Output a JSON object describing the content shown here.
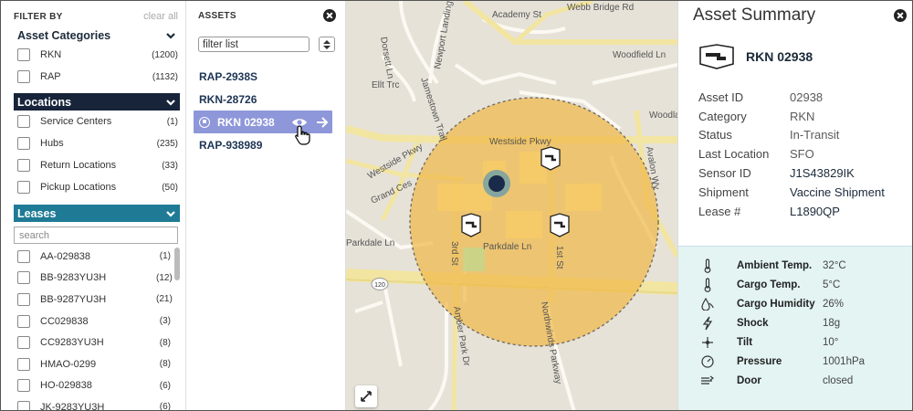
{
  "filter": {
    "title": "FILTER BY",
    "clear_all": "clear all",
    "asset_categories": {
      "label": "Asset Categories",
      "items": [
        {
          "label": "RKN",
          "count": "(1200)"
        },
        {
          "label": "RAP",
          "count": "(1132)"
        }
      ]
    },
    "locations": {
      "label": "Locations",
      "items": [
        {
          "label": "Service Centers",
          "count": "(1)"
        },
        {
          "label": "Hubs",
          "count": "(235)"
        },
        {
          "label": "Return Locations",
          "count": "(33)"
        },
        {
          "label": "Pickup Locations",
          "count": "(50)"
        }
      ]
    },
    "leases": {
      "label": "Leases",
      "search_placeholder": "search",
      "items": [
        {
          "label": "AA-029838",
          "count": "(1)"
        },
        {
          "label": "BB-9283YU3H",
          "count": "(12)"
        },
        {
          "label": "BB-9287YU3H",
          "count": "(21)"
        },
        {
          "label": "CC029838",
          "count": "(3)"
        },
        {
          "label": "CC9283YU3H",
          "count": "(8)"
        },
        {
          "label": "HMAO-0299",
          "count": "(8)"
        },
        {
          "label": "HO-029838",
          "count": "(6)"
        },
        {
          "label": "JK-9283YU3H",
          "count": "(6)"
        }
      ]
    }
  },
  "assets": {
    "title": "ASSETS",
    "filter_placeholder": "filter list",
    "items": [
      {
        "label": "RAP-2938S",
        "selected": false
      },
      {
        "label": "RKN-28726",
        "selected": false
      },
      {
        "label": "RKN 02938",
        "selected": true
      },
      {
        "label": "RAP-938989",
        "selected": false
      }
    ]
  },
  "map": {
    "street_labels": [
      "Academy St",
      "Webb Bridge Rd",
      "Jamestown Trail",
      "Dorsett Ln",
      "Newport Landing",
      "Woodfield Ln",
      "Woodland Te",
      "Westside Pkwy",
      "Avalon Wy",
      "Grand Ces",
      "Parkdale Ln",
      "3rd St",
      "Northwinds Parkway",
      "Amber Park Dr",
      "1st St",
      "Ellt Trc",
      "Parkdale Ln"
    ],
    "highway_shield": "120",
    "geofence_color": "#f0b84a",
    "marker_color": "#1a2a4a"
  },
  "summary": {
    "title": "Asset Summary",
    "asset_name": "RKN 02938",
    "fields": [
      {
        "label": "Asset ID",
        "value": "02938",
        "dark": false
      },
      {
        "label": "Category",
        "value": "RKN",
        "dark": false
      },
      {
        "label": "Status",
        "value": "In-Transit",
        "dark": false
      },
      {
        "label": "Last Location",
        "value": "SFO",
        "dark": false
      },
      {
        "label": "Sensor ID",
        "value": "J1S43829IK",
        "dark": true
      },
      {
        "label": "Shipment",
        "value": "Vaccine Shipment",
        "dark": true
      },
      {
        "label": "Lease #",
        "value": "L1890QP",
        "dark": true
      }
    ],
    "sensors": [
      {
        "icon": "thermometer-icon",
        "label": "Ambient Temp.",
        "value": "32°C"
      },
      {
        "icon": "thermometer-icon",
        "label": "Cargo Temp.",
        "value": "5°C"
      },
      {
        "icon": "humidity-icon",
        "label": "Cargo Humidity",
        "value": "26%"
      },
      {
        "icon": "lightning-icon",
        "label": "Shock",
        "value": "18g"
      },
      {
        "icon": "tilt-icon",
        "label": "Tilt",
        "value": "10°"
      },
      {
        "icon": "pressure-gauge-icon",
        "label": "Pressure",
        "value": "1001hPa"
      },
      {
        "icon": "door-icon",
        "label": "Door",
        "value": "closed"
      }
    ]
  }
}
